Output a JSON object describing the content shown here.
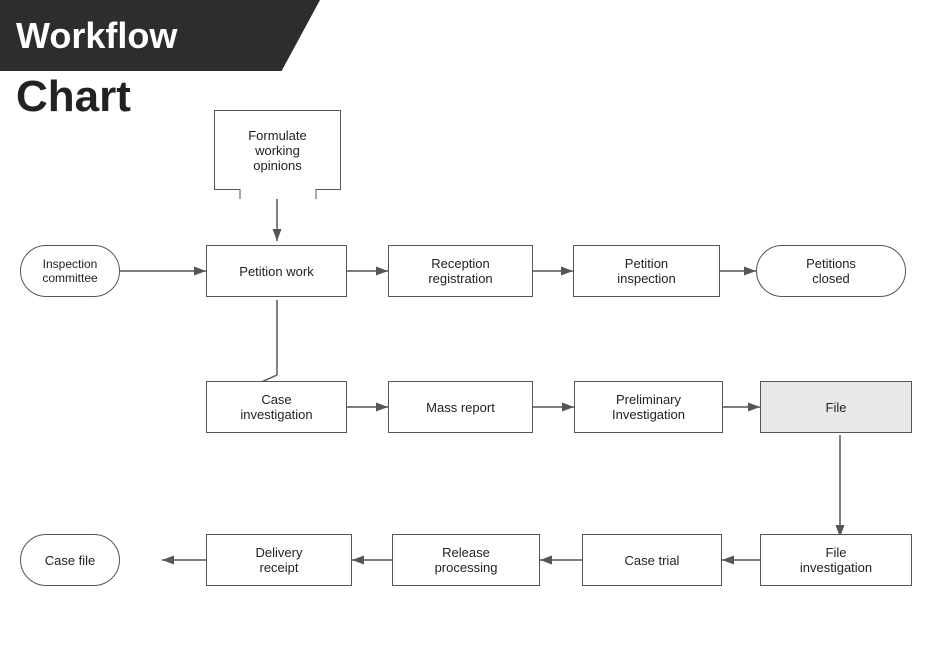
{
  "header": {
    "title": "Workflow",
    "chart_label": "Chart"
  },
  "nodes": {
    "formulate": {
      "label": "Formulate\nworking\nopinions"
    },
    "inspection_committee": {
      "label": "Inspection\ncommittee"
    },
    "petition_work": {
      "label": "Petition work"
    },
    "reception_registration": {
      "label": "Reception\nregistration"
    },
    "petition_inspection": {
      "label": "Petition\ninspection"
    },
    "petitions_closed": {
      "label": "Petitions\nclosed"
    },
    "case_investigation": {
      "label": "Case\ninvestigation"
    },
    "mass_report": {
      "label": "Mass report"
    },
    "preliminary_investigation": {
      "label": "Preliminary\nInvestigation"
    },
    "file": {
      "label": "File"
    },
    "case_file": {
      "label": "Case file"
    },
    "delivery_receipt": {
      "label": "Delivery\nreceipt"
    },
    "release_processing": {
      "label": "Release\nprocessing"
    },
    "case_trial": {
      "label": "Case trial"
    },
    "file_investigation": {
      "label": "File\ninvestigation"
    }
  }
}
